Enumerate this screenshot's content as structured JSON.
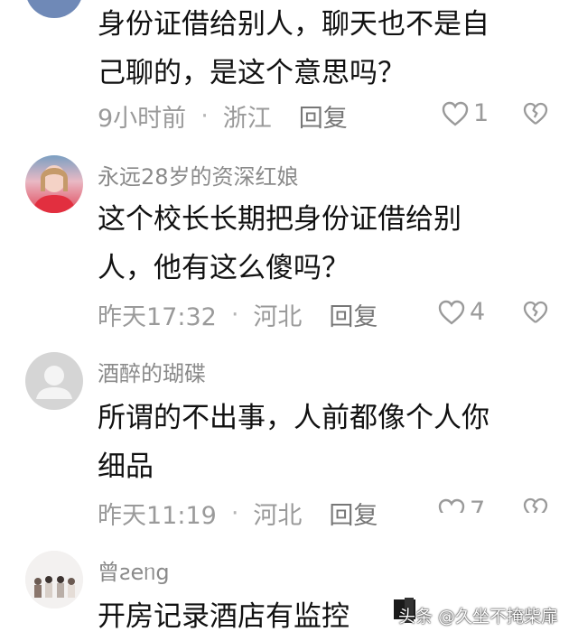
{
  "comments": [
    {
      "username": "",
      "text_lines": [
        "身份证借给别人，聊天也不是自",
        "己聊的，是这个意思吗？"
      ],
      "time": "9小时前",
      "location": "浙江",
      "reply": "回复",
      "likes": "1"
    },
    {
      "username": "永远28岁的资深红娘",
      "text_lines": [
        "这个校长长期把身份证借给别",
        "人，他有这么傻吗？"
      ],
      "time": "昨天17:32",
      "location": "河北",
      "reply": "回复",
      "likes": "4"
    },
    {
      "username": "酒醉的瑚碟",
      "text_lines": [
        "所谓的不出事，人前都像个人你",
        "细品"
      ],
      "time": "昨天11:19",
      "location": "河北",
      "reply": "回复",
      "likes": "7"
    },
    {
      "username": "曾ƨeᥒg",
      "text_lines": [
        "开房记录酒店有监控"
      ],
      "time": "",
      "location": "",
      "reply": "",
      "likes": ""
    }
  ],
  "watermark": "头条 @久坐不掩柴扉",
  "icons": {
    "like": "heart-outline-icon",
    "dislike": "broken-heart-icon",
    "default_avatar": "default-avatar-icon"
  }
}
